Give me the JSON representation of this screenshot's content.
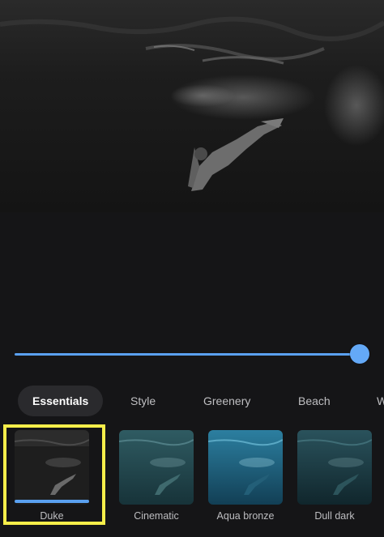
{
  "editor": {
    "intensity_fraction": 1.0,
    "accent_color": "#5aa0f0",
    "selection_highlight_color": "#f7ee4a"
  },
  "tabs": [
    {
      "label": "Essentials",
      "active": true
    },
    {
      "label": "Style",
      "active": false
    },
    {
      "label": "Greenery",
      "active": false
    },
    {
      "label": "Beach",
      "active": false
    },
    {
      "label": "W",
      "active": false
    }
  ],
  "filters": [
    {
      "label": "Duke",
      "selected": true
    },
    {
      "label": "Cinematic",
      "selected": false
    },
    {
      "label": "Aqua bronze",
      "selected": false
    },
    {
      "label": "Dull dark",
      "selected": false
    }
  ]
}
